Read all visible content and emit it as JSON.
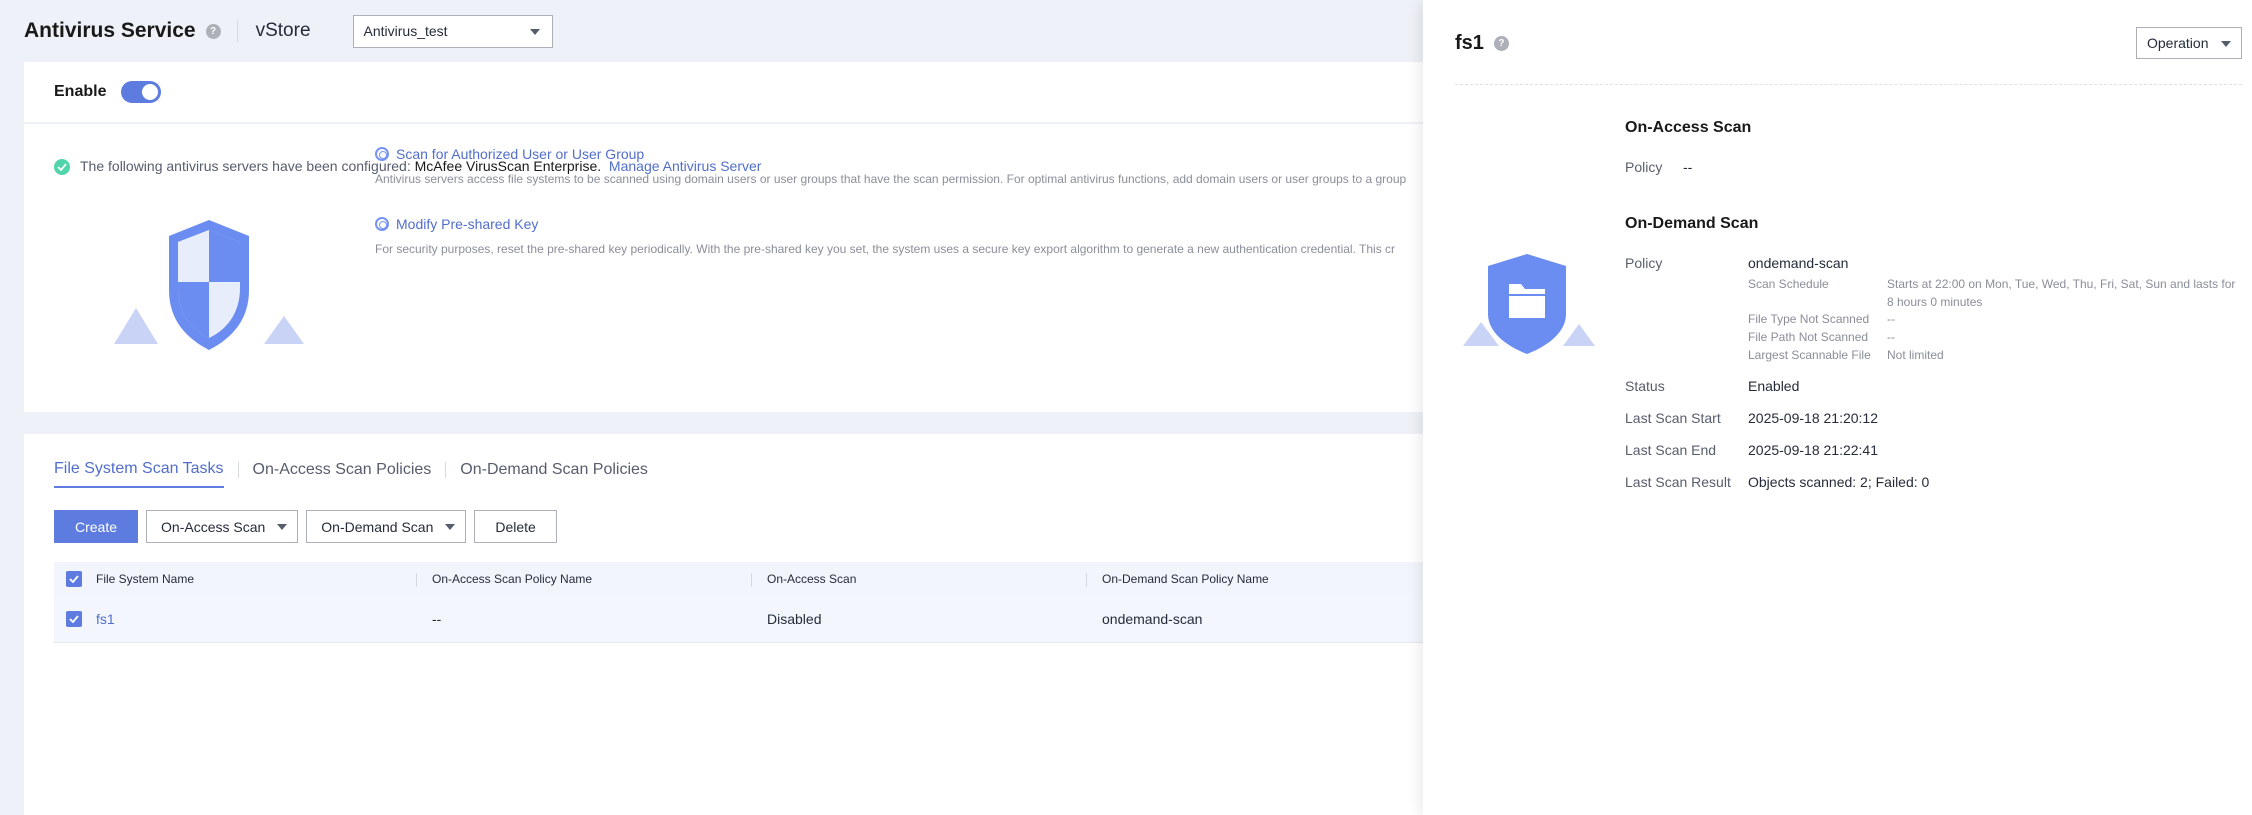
{
  "header": {
    "title": "Antivirus Service",
    "vstore_label": "vStore",
    "vstore_select": "Antivirus_test"
  },
  "enable": {
    "label": "Enable",
    "state": "on"
  },
  "info": {
    "configured_prefix": "The following antivirus servers have been configured: ",
    "server_name": "McAfee VirusScan Enterprise.",
    "manage_link": "Manage Antivirus Server",
    "features": [
      {
        "title": "Scan for Authorized User or User Group",
        "desc": "Antivirus servers access file systems to be scanned using domain users or user groups that have the scan permission. For optimal antivirus functions, add domain users or user groups to a group"
      },
      {
        "title": "Modify Pre-shared Key",
        "desc": "For security purposes, reset the pre-shared key periodically. With the pre-shared key you set, the system uses a secure key export algorithm to generate a new authentication credential. This cr"
      }
    ]
  },
  "tabs": [
    "File System Scan Tasks",
    "On-Access Scan Policies",
    "On-Demand Scan Policies"
  ],
  "toolbar": {
    "create": "Create",
    "on_access": "On-Access Scan",
    "on_demand": "On-Demand Scan",
    "delete": "Delete"
  },
  "table": {
    "columns": [
      "File System Name",
      "On-Access Scan Policy Name",
      "On-Access Scan",
      "On-Demand Scan Policy Name"
    ],
    "rows": [
      [
        "fs1",
        "--",
        "Disabled",
        "ondemand-scan"
      ]
    ]
  },
  "drawer": {
    "title": "fs1",
    "operation": "Operation",
    "on_access": {
      "title": "On-Access Scan",
      "policy_label": "Policy",
      "policy_value": "--"
    },
    "on_demand": {
      "title": "On-Demand Scan",
      "policy_label": "Policy",
      "policy_value": "ondemand-scan",
      "schedule_label": "Scan Schedule",
      "schedule_value": "Starts at 22:00 on Mon, Tue, Wed, Thu, Fri, Sat, Sun and lasts for 8 hours 0 minutes",
      "file_type_label": "File Type Not Scanned",
      "file_type_value": "--",
      "file_path_label": "File Path Not Scanned",
      "file_path_value": "--",
      "largest_label": "Largest Scannable File",
      "largest_value": "Not limited",
      "status_label": "Status",
      "status_value": "Enabled",
      "start_label": "Last Scan Start",
      "start_value": "2025-09-18 21:20:12",
      "end_label": "Last Scan End",
      "end_value": "2025-09-18 21:22:41",
      "result_label": "Last Scan Result",
      "result_value": "Objects scanned: 2; Failed: 0"
    }
  },
  "colors": {
    "accent": "#5e7ce0",
    "link": "#526ecc",
    "success": "#50d4ab"
  }
}
